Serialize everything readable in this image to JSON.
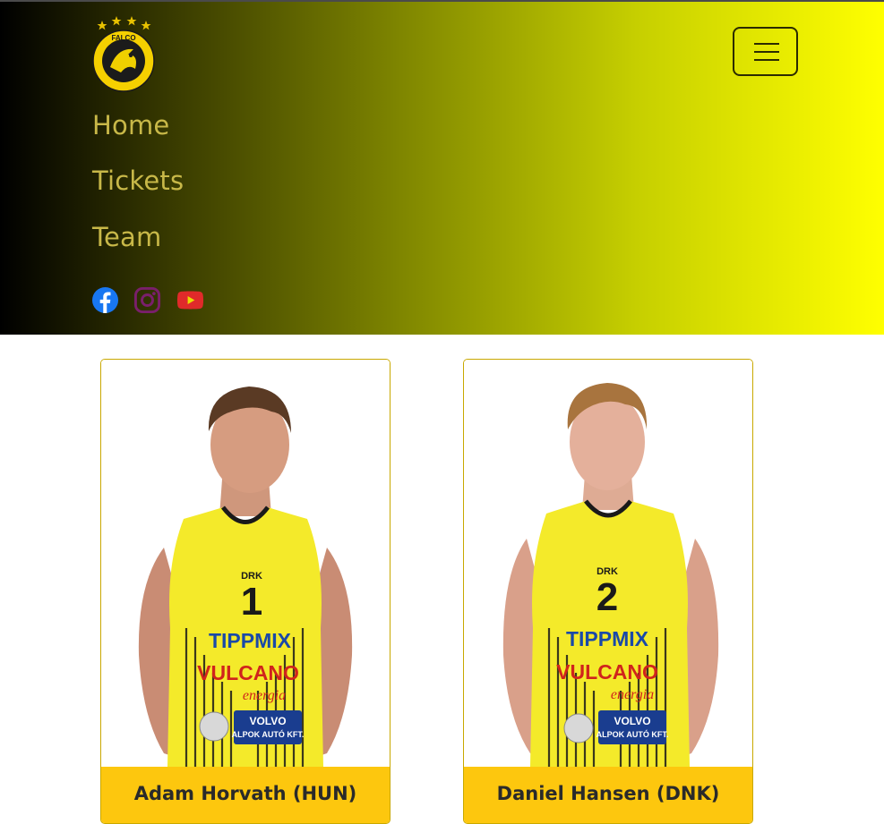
{
  "brand": {
    "logo_text": "FALCO",
    "logo_subtext": "KOSÁRLABDA CLUB SZOMBATHELY",
    "colors": {
      "accent": "#ffff00",
      "gold": "#c8b848",
      "caption_bg": "#fdc70e"
    }
  },
  "nav": {
    "toggler_icon": "hamburger-icon",
    "links": [
      {
        "label": "Home"
      },
      {
        "label": "Tickets"
      },
      {
        "label": "Team"
      }
    ]
  },
  "social": [
    {
      "icon": "facebook-icon",
      "color": "#1877f2"
    },
    {
      "icon": "instagram-icon",
      "color": "#7a1f6b"
    },
    {
      "icon": "youtube-icon",
      "color": "#e02a2a"
    }
  ],
  "players": [
    {
      "name": "Adam Horvath (HUN)",
      "jersey_number": "1",
      "sponsor_1": "TIPPMIX",
      "sponsor_2": "VULCANO",
      "sponsor_3": "energia",
      "sponsor_4": "VOLVO",
      "sponsor_5": "ALPOK AUTÓ KFT.",
      "sponsor_6": "DRK"
    },
    {
      "name": "Daniel Hansen (DNK)",
      "jersey_number": "2",
      "sponsor_1": "TIPPMIX",
      "sponsor_2": "VULCANO",
      "sponsor_3": "energia",
      "sponsor_4": "VOLVO",
      "sponsor_5": "ALPOK AUTÓ KFT.",
      "sponsor_6": "DRK"
    }
  ]
}
